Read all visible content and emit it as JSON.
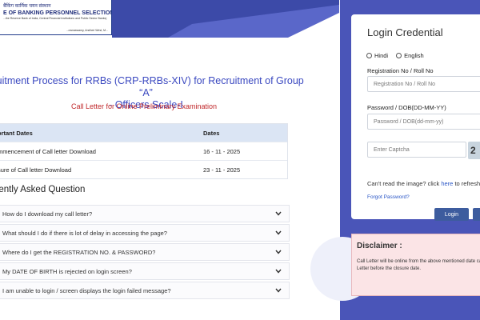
{
  "header": {
    "logo_hindi": "बैंकिंग कार्मिक चयन संस्थान",
    "logo_english": "E OF BANKING PERSONNEL SELECTION",
    "logo_tagline": "...the Reserve Bank of India, Central Financial Institutions and Public Sector Banks)",
    "logo_address": "...ownaswamy, Andheri West, M..."
  },
  "main": {
    "title_line1": "cruitment Process for RRBs (CRP-RRBs-XIV) for Recruitment of Group “A”",
    "title_line2": "- Officers Scale-I",
    "call_letter_title": "Call Letter for Online Preliminary Examination",
    "dates_table": {
      "headers": [
        "ortant Dates",
        "Dates"
      ],
      "rows": [
        [
          "mmencement of Call letter Download",
          "16 - 11 - 2025"
        ],
        [
          "sure of Call letter Download",
          "23 - 11 - 2025"
        ]
      ]
    },
    "faq_title": "uently Asked Question",
    "faq": [
      "How do I download my call letter?",
      "What should I do if there is lot of delay in accessing the page?",
      "Where do I get the REGISTRATION NO. & PASSWORD?",
      "My DATE OF BIRTH is rejected on login screen?",
      "I am unable to login / screen displays the login failed message?"
    ]
  },
  "login": {
    "title": "Login Credential",
    "lang_hindi": "Hindi",
    "lang_english": "English",
    "reg_label": "Registration No / Roll No",
    "reg_placeholder": "Registration No / Roll No",
    "pwd_label": "Password / DOB(DD-MM-YY)",
    "pwd_placeholder": "Password / DOB(dd-mm-yy)",
    "captcha_placeholder": "Enter Captcha",
    "captcha_text": "2",
    "cant_read": "Can't read the image? click",
    "here": "here",
    "to_refresh": "to refresh",
    "forgot": "Forgot Password?",
    "login_btn": "Login"
  },
  "disclaimer": {
    "title": "Disclaimer :",
    "text": "Call Letter will be online from the above mentioned date call Letter before the closure date."
  },
  "colors": {
    "panel": "#4a55b8",
    "title_blue": "#3b49c0",
    "call_red": "#c0282b",
    "button": "#3d5c9e"
  }
}
